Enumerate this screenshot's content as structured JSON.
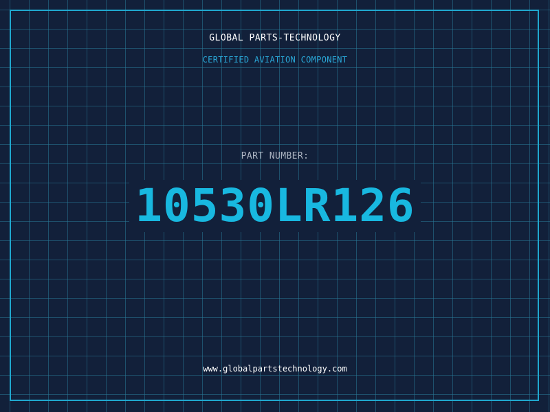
{
  "header": {
    "company_name": "GLOBAL PARTS-TECHNOLOGY",
    "subtitle": "CERTIFIED AVIATION COMPONENT"
  },
  "part": {
    "label": "PART NUMBER:",
    "number": "10530LR126"
  },
  "footer": {
    "website": "www.globalpartstechnology.com"
  },
  "colors": {
    "background": "#12203a",
    "grid": "#28789a",
    "frame": "#20a8cf",
    "accent": "#18b8e0",
    "subtitle": "#2aa9d9",
    "label": "#aeb6c3",
    "text": "#ffffff"
  }
}
